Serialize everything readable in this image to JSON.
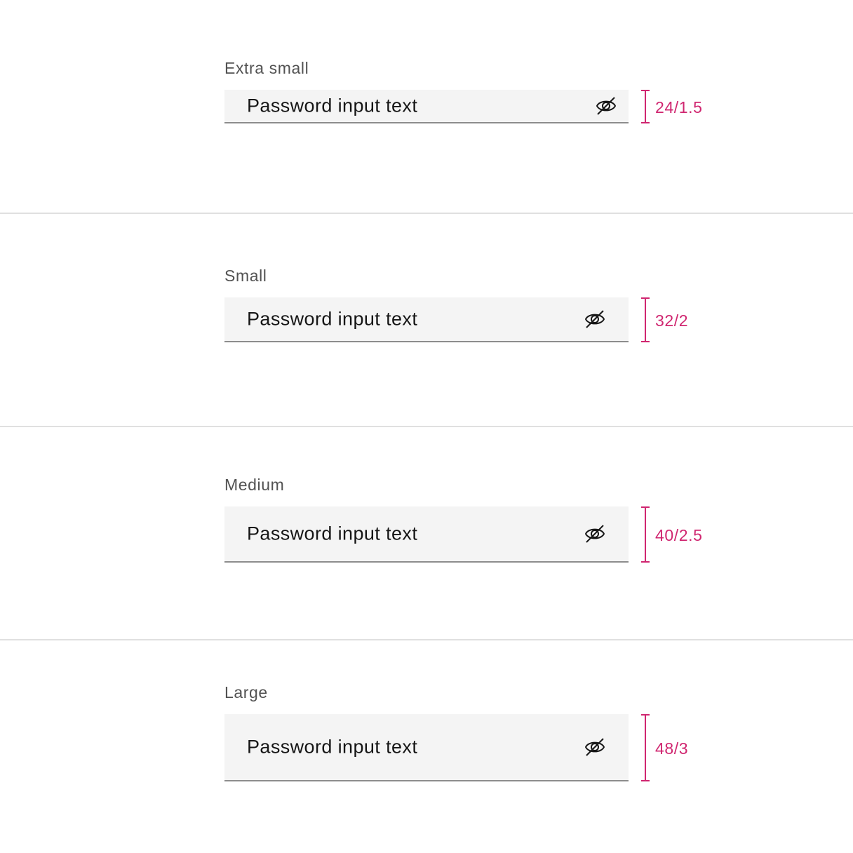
{
  "colors": {
    "label": "#525252",
    "text": "#161616",
    "field_bg": "#f4f4f4",
    "field_border": "#8d8d8d",
    "annotation": "#d02670",
    "divider": "#e0e0e0"
  },
  "variants": [
    {
      "label": "Extra small",
      "value": "Password input text",
      "icon": "view-off-icon",
      "spec": "24/1.5"
    },
    {
      "label": "Small",
      "value": "Password input text",
      "icon": "view-off-icon",
      "spec": "32/2"
    },
    {
      "label": "Medium",
      "value": "Password input text",
      "icon": "view-off-icon",
      "spec": "40/2.5"
    },
    {
      "label": "Large",
      "value": "Password input text",
      "icon": "view-off-icon",
      "spec": "48/3"
    }
  ]
}
